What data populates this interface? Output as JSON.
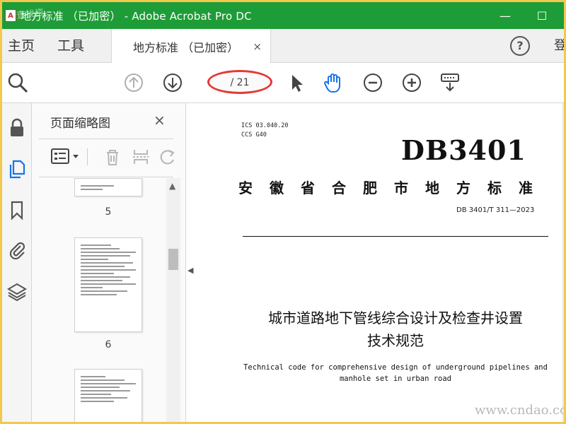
{
  "window": {
    "title": "地方标准 （已加密） - Adobe Acrobat Pro DC",
    "app_icon_glyph": "A",
    "watermark_top_left": "查找资",
    "minimize_glyph": "—",
    "maximize_glyph": "☐"
  },
  "menu": {
    "home": "主页",
    "tools": "工具",
    "tab_label": "地方标准 （已加密）",
    "tab_close": "×",
    "help": "?",
    "login_partial": "登"
  },
  "toolbar": {
    "page_current": "",
    "page_total": "/ 21",
    "icons": [
      "search-zoom-icon",
      "prev-page-icon",
      "next-page-icon",
      "select-cursor-icon",
      "hand-tool-icon",
      "zoom-out-icon",
      "zoom-in-icon",
      "keyboard-tool-icon"
    ]
  },
  "rail": {
    "icons": [
      "lock-icon",
      "pages-icon",
      "bookmark-icon",
      "attachment-icon",
      "layers-icon"
    ],
    "active": "pages-icon",
    "accent": "#1a73e8"
  },
  "panel": {
    "title": "页面缩略图",
    "close": "×",
    "thumbnails": [
      {
        "label": "5"
      },
      {
        "label": "6"
      },
      {
        "label": ""
      }
    ]
  },
  "document": {
    "ics_line": "ICS 03.040.20",
    "ccs_line": "CCS G40",
    "db_code": "DB3401",
    "province_title": "安徽省合肥市地方标准",
    "standard_number": "DB 3401/T 311—2023",
    "title_cn_line1": "城市道路地下管线综合设计及检查井设置",
    "title_cn_line2": "技术规范",
    "title_en_line1": "Technical code for comprehensive design of underground pipelines and",
    "title_en_line2": "manhole set in urban road"
  },
  "watermark_bottom_right": "www.cndao.com",
  "colors": {
    "titlebar": "#1e9c37",
    "border": "#f2c94c",
    "highlight": "#e53935"
  }
}
